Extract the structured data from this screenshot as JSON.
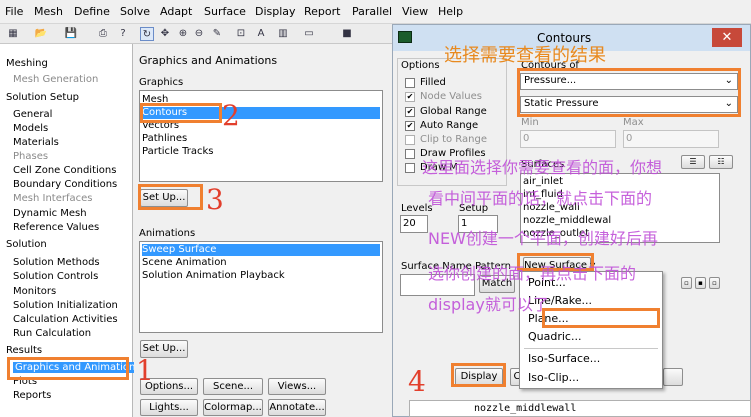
{
  "menu": [
    "File",
    "Mesh",
    "Define",
    "Solve",
    "Adapt",
    "Surface",
    "Display",
    "Report",
    "Parallel",
    "View",
    "Help"
  ],
  "toolbar_icons": [
    "open-icon",
    "save-icon",
    "print-icon",
    "help-icon",
    "rotate-icon",
    "translate-icon",
    "zoom-in-icon",
    "zoom-out-icon",
    "probe-icon",
    "zoom-fit-icon",
    "annotate-icon",
    "layout-icon",
    "window-icon"
  ],
  "tree": {
    "meshing": "Meshing",
    "mesh_generation": "Mesh Generation",
    "solution_setup": "Solution Setup",
    "general": "General",
    "models": "Models",
    "materials": "Materials",
    "phases": "Phases",
    "cell_zone_conditions": "Cell Zone Conditions",
    "boundary_conditions": "Boundary Conditions",
    "mesh_interfaces": "Mesh Interfaces",
    "dynamic_mesh": "Dynamic Mesh",
    "reference_values": "Reference Values",
    "solution": "Solution",
    "solution_methods": "Solution Methods",
    "solution_controls": "Solution Controls",
    "monitors": "Monitors",
    "solution_initialization": "Solution Initialization",
    "calculation_activities": "Calculation Activities",
    "run_calculation": "Run Calculation",
    "results": "Results",
    "graphics_and_animations": "Graphics and Animations",
    "plots": "Plots",
    "reports": "Reports"
  },
  "panel": {
    "title": "Graphics and Animations",
    "graphics_label": "Graphics",
    "graphics_items": [
      "Mesh",
      "Contours",
      "Vectors",
      "Pathlines",
      "Particle Tracks"
    ],
    "setup1": "Set Up...",
    "animations_label": "Animations",
    "animation_items": [
      "Sweep Surface",
      "Scene Animation",
      "Solution Animation Playback"
    ],
    "setup2": "Set Up...",
    "buttons": [
      "Options...",
      "Scene...",
      "Views...",
      "Lights...",
      "Colormap...",
      "Annotate..."
    ]
  },
  "dialog": {
    "title": "Contours",
    "close": "✕",
    "options_label": "Options",
    "options": [
      {
        "label": "Filled",
        "checked": false,
        "enabled": true
      },
      {
        "label": "Node Values",
        "checked": true,
        "enabled": false
      },
      {
        "label": "Global Range",
        "checked": true,
        "enabled": true
      },
      {
        "label": "Auto Range",
        "checked": true,
        "enabled": true
      },
      {
        "label": "Clip to Range",
        "checked": false,
        "enabled": false
      },
      {
        "label": "Draw Profiles",
        "checked": false,
        "enabled": true
      },
      {
        "label": "Draw M",
        "checked": false,
        "enabled": true
      }
    ],
    "contours_of_label": "Contours of",
    "contours_of": "Pressure...",
    "contours_sub": "Static Pressure",
    "min_label": "Min",
    "max_label": "Max",
    "min_value": "0",
    "max_value": "0",
    "surfaces_label": "Surfaces",
    "surfaces": [
      "air_inlet",
      "int_fluid",
      "nozzle_wall",
      "nozzle_middlewal",
      "nozzle_outlet"
    ],
    "levels_label": "Levels",
    "levels": "20",
    "setup_label": "Setup",
    "setup_value": "1",
    "surface_name_pattern_label": "Surface Name Pattern",
    "match": "Match",
    "new_surface": "New Surface",
    "display": "Display",
    "comp": "C",
    "dropdown_items": [
      "Point...",
      "Line/Rake...",
      "Plane...",
      "Quadric...",
      "Iso-Surface...",
      "Iso-Clip..."
    ]
  },
  "bottom_label": "nozzle_middlewall",
  "annotations": {
    "n1": "1",
    "n2": "2",
    "n3": "3",
    "n4": "4",
    "note_top": "选择需要查看的结果",
    "note_mid1": "这里面选择你需要查看的面，你想",
    "note_mid2": "看中间平面的话，就点击下面的",
    "note_mid3": "NEW创建一个平面，创建好后再",
    "note_mid4": "选你创建的面，再点击下面的",
    "note_mid5": "display就可以了"
  },
  "colors": {
    "selection": "#3399ff",
    "annotation_box": "#f08030",
    "annotation_number": "#e23f2c",
    "annotation_text": "#c050d8"
  }
}
